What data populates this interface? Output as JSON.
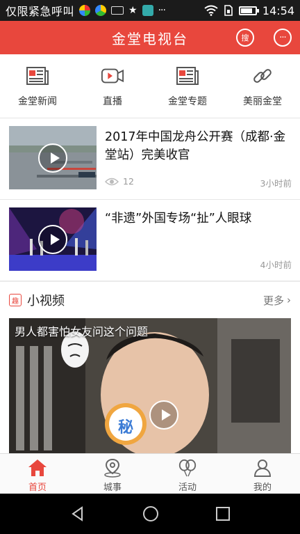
{
  "status_bar": {
    "carrier": "仅限紧急呼叫",
    "time": "14:54",
    "battery_level": 0.75,
    "notification_icons": [
      "app-icon-1",
      "app-icon-2",
      "keyboard-icon",
      "star-icon",
      "app-icon-3",
      "more-icon"
    ]
  },
  "header": {
    "title": "金堂电视台",
    "search_label": "搜",
    "accent_color": "#e8473d"
  },
  "quick_nav": [
    {
      "label": "金堂新闻",
      "icon": "newspaper-icon"
    },
    {
      "label": "直播",
      "icon": "video-camera-icon"
    },
    {
      "label": "金堂专题",
      "icon": "newspaper-icon"
    },
    {
      "label": "美丽金堂",
      "icon": "link-icon"
    }
  ],
  "news": [
    {
      "title": "2017年中国龙舟公开赛（成都·金堂站）完美收官",
      "views": "12",
      "time": "3小时前"
    },
    {
      "title": "“非遗”外国专场“扯”人眼球",
      "views": "",
      "time": "4小时前"
    }
  ],
  "short_video": {
    "badge": "趣",
    "title": "小视频",
    "more": "更多",
    "caption": "男人都害怕女友问这个问题",
    "stamp_text": "秘"
  },
  "tabs": [
    {
      "label": "首页",
      "icon": "home-icon",
      "active": true
    },
    {
      "label": "城事",
      "icon": "location-icon",
      "active": false
    },
    {
      "label": "活动",
      "icon": "balloon-icon",
      "active": false
    },
    {
      "label": "我的",
      "icon": "user-icon",
      "active": false
    }
  ]
}
